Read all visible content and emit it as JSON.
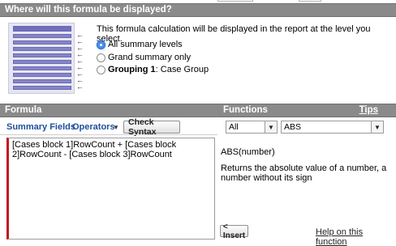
{
  "display_section": {
    "title": "Where will this formula be displayed?",
    "description": "This formula calculation will be displayed in the report at the level you select.",
    "options": [
      {
        "label": "All summary levels",
        "checked": true
      },
      {
        "label": "Grand summary only",
        "checked": false
      },
      {
        "label_bold": "Grouping 1",
        "label_rest": ": Case Group",
        "checked": false
      }
    ]
  },
  "formula_section": {
    "title": "Formula",
    "summary_fields_label": "Summary Fields",
    "operators_label": "Operators",
    "check_syntax_label": "Check Syntax",
    "formula_text": "[Cases block 1]RowCount + [Cases block 2]RowCount - [Cases block 3]RowCount"
  },
  "functions_section": {
    "title": "Functions",
    "tips_label": "Tips",
    "category_value": "All",
    "function_value": "ABS",
    "signature": "ABS(number)",
    "description": "Returns the absolute value of a number, a number without its sign",
    "insert_label": "< Insert",
    "help_label": "Help on this function"
  },
  "icons": {
    "arrow": "←",
    "caret_down": "▼"
  },
  "colors": {
    "section_bar": "#8a8a8a",
    "link_blue": "#1f4f9c",
    "required_red": "#c4161c",
    "radio_selected": "#4a8ee8"
  }
}
